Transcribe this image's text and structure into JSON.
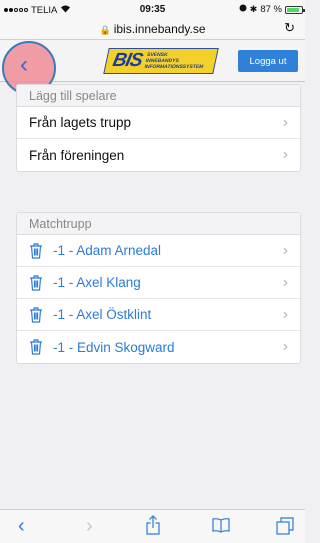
{
  "status_bar": {
    "carrier": "TELIA",
    "time": "09:35",
    "battery_text": "87 %",
    "battery_level": 0.87,
    "signal_bars_filled": 2
  },
  "url_bar": {
    "url": "ibis.innebandy.se"
  },
  "header": {
    "logo_text": "BIS",
    "logo_subtext": "SVENSK INNEBANDYS INFORMATIONSSYSTEM",
    "logout_label": "Logga ut"
  },
  "add_players": {
    "title": "Lägg till spelare",
    "items": [
      {
        "label": "Från lagets trupp"
      },
      {
        "label": "Från föreningen"
      }
    ]
  },
  "match_squad": {
    "title": "Matchtrupp",
    "players": [
      {
        "label": "-1 - Adam Arnedal"
      },
      {
        "label": "-1 - Axel Klang"
      },
      {
        "label": "-1 - Axel Östklint"
      },
      {
        "label": "-1 - Edvin Skogward"
      }
    ]
  },
  "colors": {
    "accent": "#2b7bd8",
    "logo_yellow": "#f3d02a",
    "logout_bg": "#2f80d8"
  }
}
